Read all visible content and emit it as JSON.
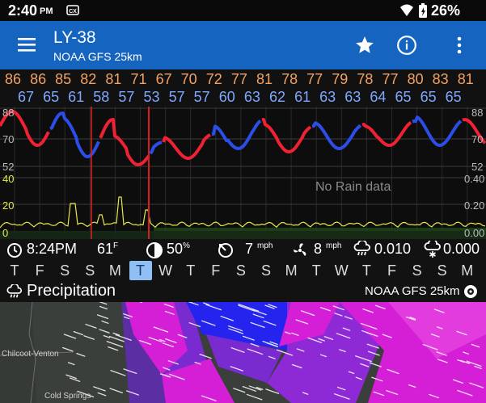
{
  "status_bar": {
    "time": "2:40",
    "ampm": "PM",
    "battery": "26%",
    "icons": [
      "cast-icon",
      "wifi-icon",
      "battery-icon"
    ]
  },
  "app_bar": {
    "title": "LY-38",
    "subtitle": "NOAA GFS 25km",
    "icons": [
      "menu-icon",
      "star-icon",
      "info-icon",
      "more-vert-icon"
    ],
    "color": "#1565c0"
  },
  "forecast": {
    "highs": [
      "86",
      "86",
      "85",
      "82",
      "81",
      "71",
      "67",
      "70",
      "72",
      "77",
      "81",
      "78",
      "77",
      "79",
      "78",
      "77",
      "80",
      "83",
      "81"
    ],
    "lows": [
      "67",
      "65",
      "61",
      "58",
      "57",
      "53",
      "57",
      "57",
      "60",
      "63",
      "62",
      "61",
      "63",
      "63",
      "64",
      "65",
      "65",
      "65"
    ],
    "high_color": "#f4a261",
    "low_color": "#7ea8ff"
  },
  "chart": {
    "temp_axis_left": [
      "88",
      "70",
      "52"
    ],
    "temp_axis_right": [
      "88",
      "70",
      "52"
    ],
    "rain_axis_left": [
      "40",
      "20",
      "0"
    ],
    "rain_axis_right": [
      "0.40",
      "0.20",
      "0.00"
    ],
    "no_data_label": "No Rain data"
  },
  "conditions": {
    "time": "8:24PM",
    "temp": "61",
    "temp_unit": "F",
    "humidity": "50",
    "humidity_unit": "%",
    "wind": "7",
    "wind_unit": "mph",
    "gust": "8",
    "gust_unit": "mph",
    "rain": "0.010",
    "snow": "0.000"
  },
  "days": {
    "labels": [
      "T",
      "F",
      "S",
      "S",
      "M",
      "T",
      "W",
      "T",
      "F",
      "S",
      "S",
      "M",
      "T",
      "W",
      "T",
      "F",
      "S",
      "S",
      "M"
    ],
    "selected_index": 5
  },
  "layer": {
    "name": "Precipitation",
    "model": "NOAA GFS 25km"
  },
  "map": {
    "places": [
      "Chilcoot-Venton",
      "Cold Springs"
    ]
  }
}
